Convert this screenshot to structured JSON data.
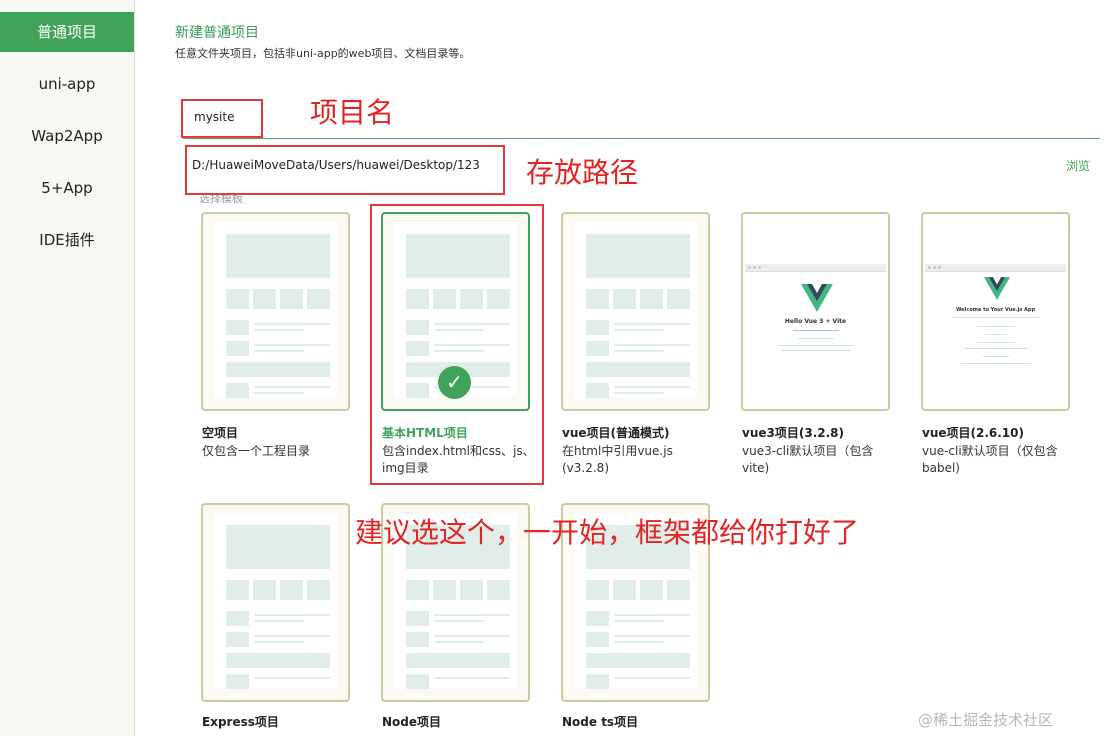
{
  "sidebar": {
    "items": [
      {
        "label": "普通项目",
        "active": true
      },
      {
        "label": "uni-app"
      },
      {
        "label": "Wap2App"
      },
      {
        "label": "5+App"
      },
      {
        "label": "IDE插件"
      }
    ]
  },
  "header": {
    "title": "新建普通项目",
    "description": "任意文件夹项目，包括非uni-app的web项目、文档目录等。"
  },
  "form": {
    "project_name": "mysite",
    "path": "D:/HuaweiMoveData/Users/huawei/Desktop/123",
    "browse_label": "浏览",
    "template_section_label": "选择模板"
  },
  "templates": [
    {
      "title": "空项目",
      "desc": "仅包含一个工程目录"
    },
    {
      "title": "基本HTML项目",
      "desc": "包含index.html和css、js、img目录",
      "selected": true
    },
    {
      "title": "vue项目(普通模式)",
      "desc": "在html中引用vue.js (v3.2.8)"
    },
    {
      "title": "vue3项目(3.2.8)",
      "desc": "vue3-cli默认项目（包含vite)",
      "preview_text": "Hello Vue 3 + Vite"
    },
    {
      "title": "vue项目(2.6.10)",
      "desc": "vue-cli默认项目（仅包含babel)",
      "preview_text": "Welcome to Your Vue.js App"
    },
    {
      "title": "Express项目",
      "desc": ""
    },
    {
      "title": "Node项目",
      "desc": ""
    },
    {
      "title": "Node ts项目",
      "desc": ""
    }
  ],
  "annotations": {
    "name": "项目名",
    "path": "存放路径",
    "tip": "建议选这个，一开始，框架都给你打好了"
  },
  "watermark": "@稀土掘金技术社区",
  "colors": {
    "accent": "#41a259",
    "annotation": "#e12424",
    "card_border": "#cfc9a0"
  }
}
